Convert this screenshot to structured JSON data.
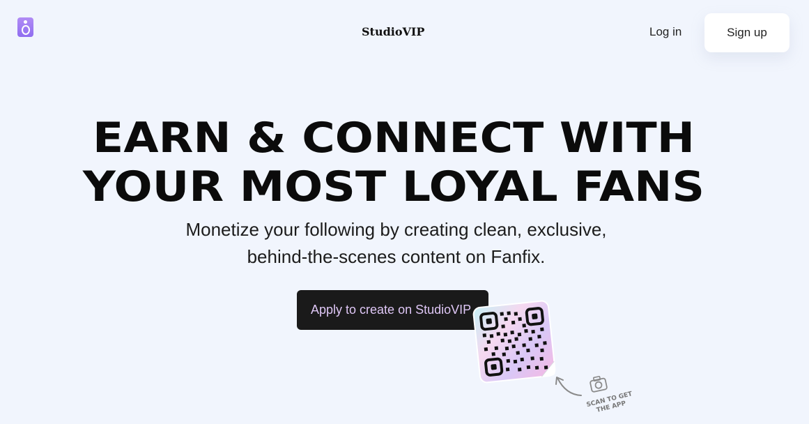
{
  "header": {
    "brand": "StudioVIP",
    "login_label": "Log in",
    "signup_label": "Sign up"
  },
  "hero": {
    "headline_line1": "EARN & CONNECT WITH",
    "headline_line2": "YOUR MOST LOYAL FANS",
    "subtitle_line1": "Monetize your following by creating clean, exclusive,",
    "subtitle_line2": "behind-the-scenes content on Fanfix.",
    "cta_label": "Apply to create on StudioVIP",
    "scan_label_line1": "SCAN TO GET",
    "scan_label_line2": "THE APP"
  },
  "icons": {
    "logo": "speaker-logo-icon",
    "qr": "qr-code-icon",
    "arrow": "curved-arrow-icon",
    "camera": "camera-icon"
  },
  "colors": {
    "background": "#f1f5fd",
    "logo_accent": "#9a78f2",
    "cta_background": "#1a1a1a",
    "cta_text": "#dfc7f6"
  }
}
